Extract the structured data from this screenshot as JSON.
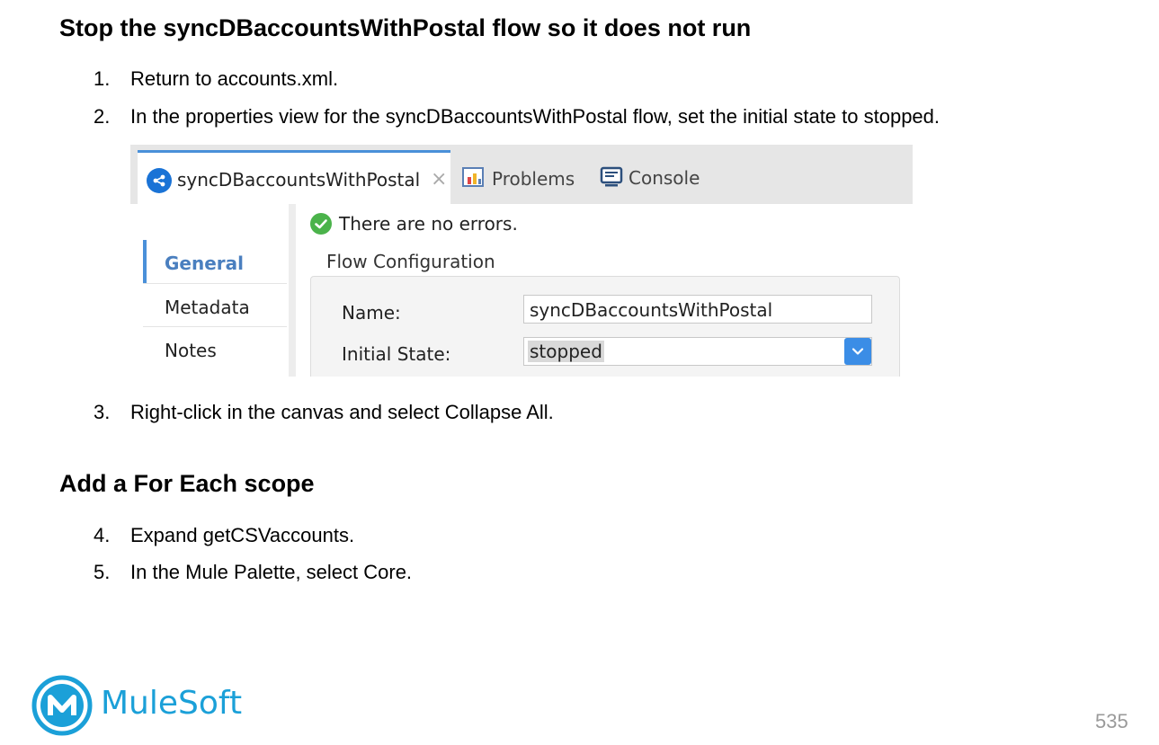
{
  "heading1": "Stop the syncDBaccountsWithPostal flow so it does not run",
  "steps_a": [
    {
      "num": "1.",
      "text": "Return to accounts.xml."
    },
    {
      "num": "2.",
      "text": "In the properties view for the syncDBaccountsWithPostal flow, set the initial state to stopped."
    }
  ],
  "screenshot": {
    "tabs": {
      "active": "syncDBaccountsWithPostal",
      "close": "×",
      "problems": "Problems",
      "console": "Console"
    },
    "status": "There are no errors.",
    "nav": [
      "General",
      "Metadata",
      "Notes"
    ],
    "section_title": "Flow Configuration",
    "form": {
      "name_label": "Name:",
      "name_value": "syncDBaccountsWithPostal",
      "state_label": "Initial State:",
      "state_value": "stopped"
    }
  },
  "step3": {
    "num": "3.",
    "text": "Right-click in the canvas and select Collapse All."
  },
  "heading2": "Add a For Each scope",
  "steps_b": [
    {
      "num": "4.",
      "text": "Expand getCSVaccounts."
    },
    {
      "num": "5.",
      "text": "In the Mule Palette, select Core."
    }
  ],
  "footer": {
    "brand": "MuleSoft",
    "page_number": "535"
  },
  "colors": {
    "accent_blue": "#4a90d9",
    "ok_green": "#4bb34b",
    "brand_blue": "#1ba0d8"
  }
}
